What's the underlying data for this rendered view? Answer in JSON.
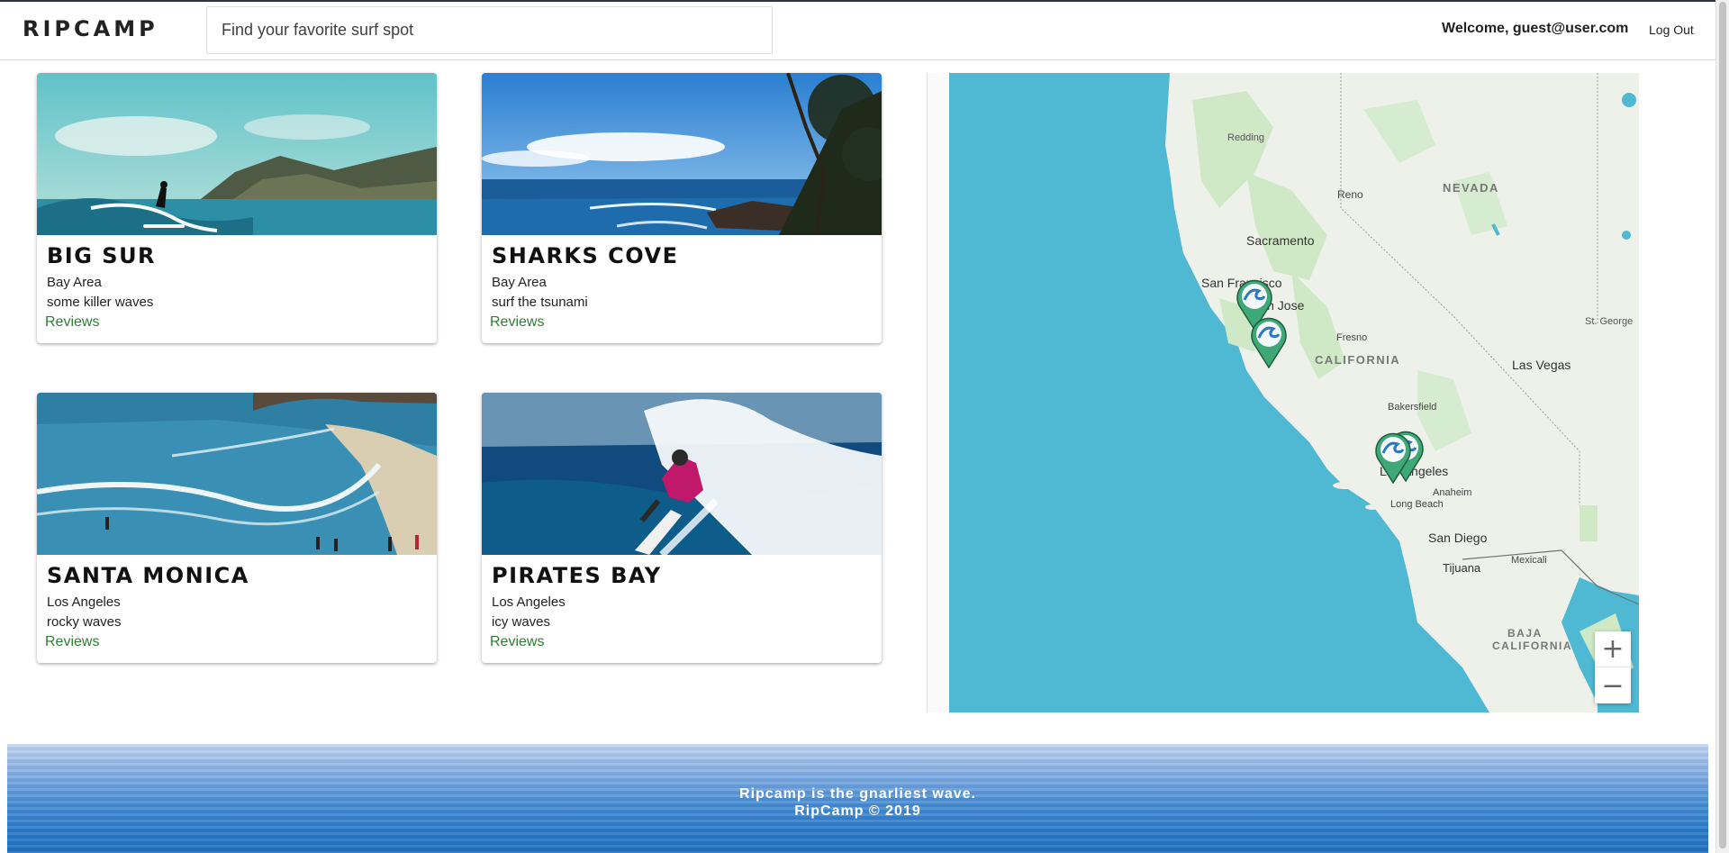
{
  "header": {
    "logo": "RIPCAMP",
    "search_placeholder": "Find your favorite surf spot",
    "welcome": "Welcome, guest@user.com",
    "logout": "Log Out"
  },
  "spots": [
    {
      "name": "BIG SUR",
      "region": "Bay Area",
      "description": "some killer waves",
      "reviews_label": "Reviews"
    },
    {
      "name": "SHARKS COVE",
      "region": "Bay Area",
      "description": "surf the tsunami",
      "reviews_label": "Reviews"
    },
    {
      "name": "SANTA MONICA",
      "region": "Los Angeles",
      "description": "rocky waves",
      "reviews_label": "Reviews"
    },
    {
      "name": "PIRATES BAY",
      "region": "Los Angeles",
      "description": "icy waves",
      "reviews_label": "Reviews"
    }
  ],
  "map": {
    "labels": {
      "redding": "Redding",
      "reno": "Reno",
      "nevada": "NEVADA",
      "sacramento": "Sacramento",
      "san_francisco": "San Francisco",
      "san_jose": "San Jose",
      "st_george": "St. George",
      "fresno": "Fresno",
      "california": "CALIFORNIA",
      "las_vegas": "Las Vegas",
      "bakersfield": "Bakersfield",
      "los_angeles": "Los Angeles",
      "anaheim": "Anaheim",
      "long_beach": "Long Beach",
      "san_diego": "San Diego",
      "tijuana": "Tijuana",
      "mexicali": "Mexicali",
      "baja": "BAJA",
      "baja_california": "CALIFORNIA"
    },
    "zoom_in": "+",
    "zoom_out": "−",
    "marker_icon": "wave-marker-icon",
    "colors": {
      "water": "#4fb8d2",
      "land": "#eef0ea",
      "marker": "#3fa877"
    }
  },
  "footer": {
    "tagline": "Ripcamp is the gnarliest wave.",
    "copyright": "RipCamp © 2019"
  }
}
